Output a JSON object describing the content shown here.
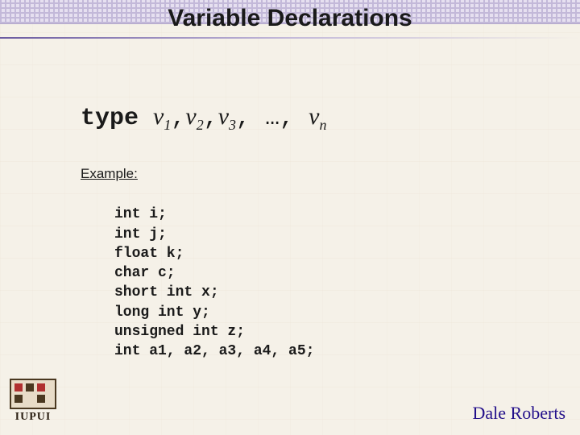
{
  "title": "Variable Declarations",
  "syntax": {
    "keyword": "type",
    "v": "v",
    "sub1": "1",
    "sub2": "2",
    "sub3": "3",
    "subn": "n",
    "ellipsis": "…",
    "comma": ",",
    "space": " "
  },
  "example": {
    "label": "Example:",
    "lines": [
      "int i;",
      "int j;",
      "float k;",
      "char c;",
      "short int x;",
      "long int y;",
      "unsigned int z;",
      "int a1, a2, a3, a4, a5;"
    ]
  },
  "logo_text": "IUPUI",
  "author": "Dale Roberts"
}
